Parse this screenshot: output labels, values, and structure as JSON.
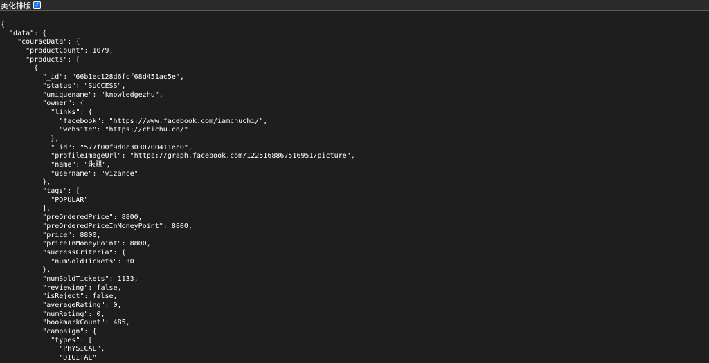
{
  "toolbar": {
    "label": "美化排版",
    "checked": true,
    "checkbox_color": "#1a73e8"
  },
  "json_lines": [
    "{",
    "  \"data\": {",
    "    \"courseData\": {",
    "      \"productCount\": 1079,",
    "      \"products\": [",
    "        {",
    "          \"_id\": \"66b1ec128d6fcf68d451ac5e\",",
    "          \"status\": \"SUCCESS\",",
    "          \"uniquename\": \"knowledgezhu\",",
    "          \"owner\": {",
    "            \"links\": {",
    "              \"facebook\": \"https://www.facebook.com/iamchuchi/\",",
    "              \"website\": \"https://chichu.co/\"",
    "            },",
    "            \"_id\": \"577f00f9d0c3030700411ec0\",",
    "            \"profileImageUrl\": \"https://graph.facebook.com/1225168867516951/picture\",",
    "            \"name\": \"朱騏\",",
    "            \"username\": \"vizance\"",
    "          },",
    "          \"tags\": [",
    "            \"POPULAR\"",
    "          ],",
    "          \"preOrderedPrice\": 8800,",
    "          \"preOrderedPriceInMoneyPoint\": 8800,",
    "          \"price\": 8800,",
    "          \"priceInMoneyPoint\": 8800,",
    "          \"successCriteria\": {",
    "            \"numSoldTickets\": 30",
    "          },",
    "          \"numSoldTickets\": 1133,",
    "          \"reviewing\": false,",
    "          \"isReject\": false,",
    "          \"averageRating\": 0,",
    "          \"numRating\": 0,",
    "          \"bookmarkCount\": 485,",
    "          \"campaign\": {",
    "            \"types\": [",
    "              \"PHYSICAL\",",
    "              \"DIGITAL\""
  ]
}
